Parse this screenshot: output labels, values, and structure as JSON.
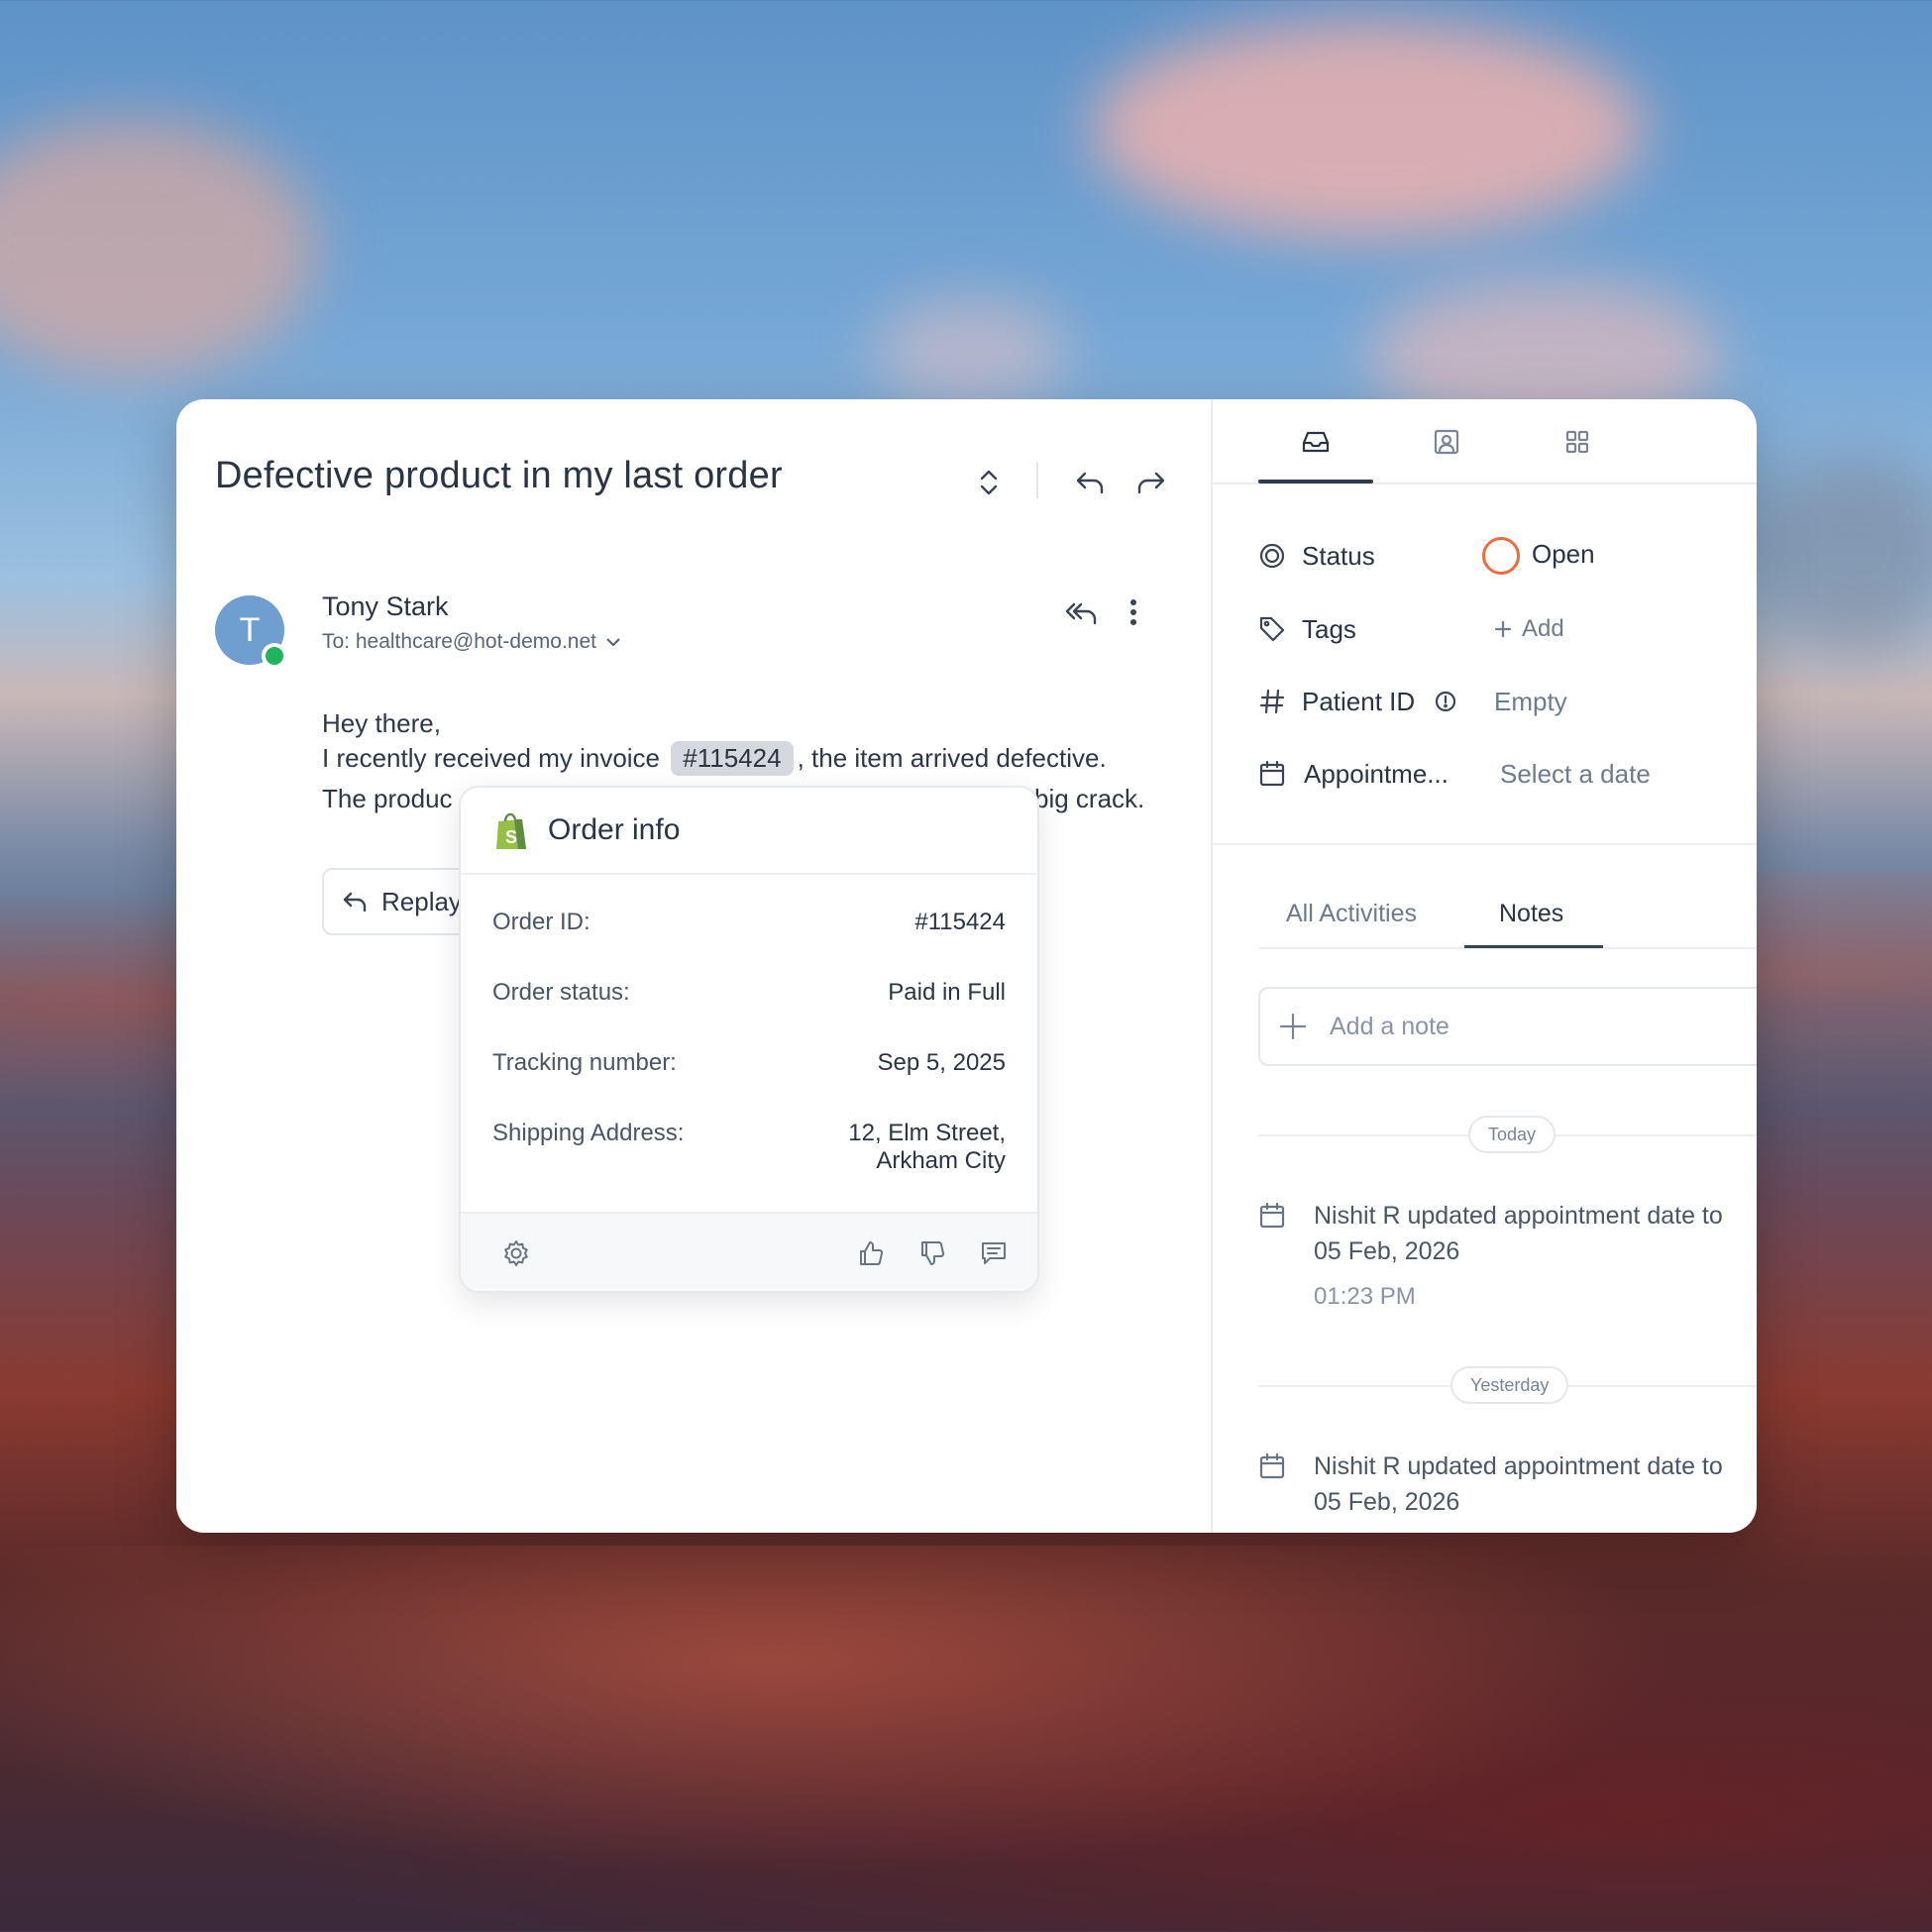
{
  "conversation": {
    "title": "Defective product in my last order"
  },
  "message": {
    "avatar_letter": "T",
    "sender_name": "Tony Stark",
    "to_line": "To: healthcare@hot-demo.net",
    "line1": "Hey there,",
    "line2_before": "I recently received my invoice",
    "invoice_ref": "#115424",
    "line2_after": ", the item arrived defective.",
    "line3_start": "The produc",
    "line3_end": "big crack.",
    "replay_label": "Replay"
  },
  "order_popup": {
    "title": "Order info",
    "rows": [
      {
        "label": "Order ID:",
        "value": "#115424"
      },
      {
        "label": "Order status:",
        "value": "Paid in Full"
      },
      {
        "label": "Tracking number:",
        "value": "Sep 5, 2025"
      },
      {
        "label": "Shipping Address:",
        "value_line1": "12, Elm Street,",
        "value_line2": "Arkham City"
      }
    ]
  },
  "properties": {
    "status_label": "Status",
    "status_value": "Open",
    "tags_label": "Tags",
    "tags_add": "Add",
    "patient_id_label": "Patient ID",
    "patient_id_value": "Empty",
    "appointment_label": "Appointme...",
    "appointment_value": "Select a date"
  },
  "activity_tabs": {
    "all": "All Activities",
    "notes": "Notes"
  },
  "notes": {
    "placeholder": "Add a note"
  },
  "timeline": {
    "today": "Today",
    "yesterday": "Yesterday",
    "item1_line1": "Nishit R updated appointment date to",
    "item1_line2": "05 Feb, 2026",
    "item1_time": "01:23 PM",
    "item2_line1": "Nishit R updated appointment date to",
    "item2_line2": "05 Feb, 2026"
  },
  "colors": {
    "status_open": "#f06a3c",
    "online": "#22b35e",
    "avatar": "#6f9fd0",
    "shopify": "#95bf47"
  }
}
